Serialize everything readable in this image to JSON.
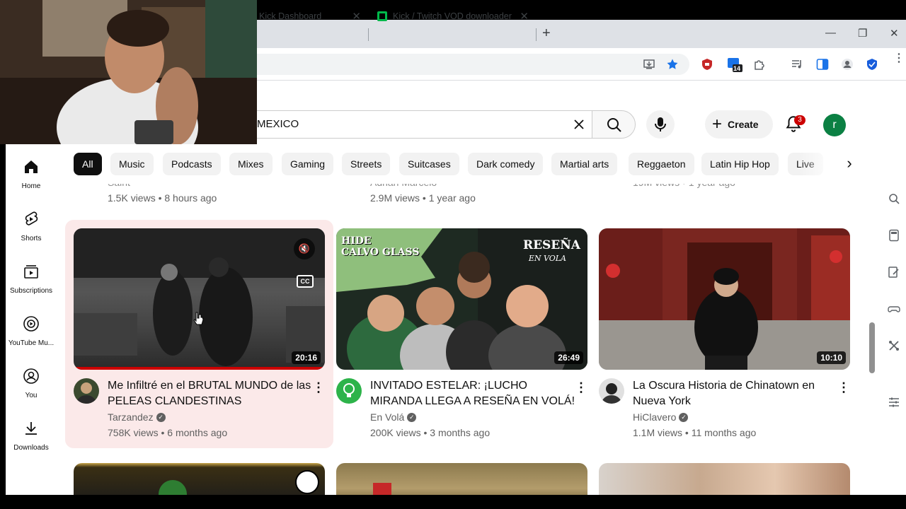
{
  "browser": {
    "tabs": [
      {
        "title": "Kick Dashboard"
      },
      {
        "title": "Kick / Twitch VOD downloader"
      }
    ],
    "new_tab_label": "+",
    "extension_badge": "14"
  },
  "header": {
    "search_query": "MEXICO",
    "create_label": "Create",
    "notifications_count": "3",
    "avatar_letter": "r"
  },
  "chips": [
    "All",
    "Music",
    "Podcasts",
    "Mixes",
    "Gaming",
    "Streets",
    "Suitcases",
    "Dark comedy",
    "Martial arts",
    "Reggaeton",
    "Latin Hip Hop",
    "Live"
  ],
  "sidebar": {
    "items": [
      {
        "label": "Home",
        "icon": "home-icon"
      },
      {
        "label": "Shorts",
        "icon": "shorts-icon"
      },
      {
        "label": "Subscriptions",
        "icon": "subscriptions-icon"
      },
      {
        "label": "YouTube Mu...",
        "icon": "youtube-music-icon"
      },
      {
        "label": "You",
        "icon": "you-icon"
      },
      {
        "label": "Downloads",
        "icon": "download-icon"
      }
    ]
  },
  "previous_row": [
    {
      "channel": "Saint",
      "stats": "1.5K views • 8 hours ago"
    },
    {
      "channel": "Adrian Marcelo",
      "stats": "2.9M views • 1 year ago"
    },
    {
      "channel": "",
      "stats": "19M views • 1 year ago"
    }
  ],
  "videos": [
    {
      "title": "Me Infiltré en el BRUTAL MUNDO de las PELEAS CLANDESTINAS",
      "channel": "Tarzandez",
      "stats": "758K views • 6 months ago",
      "duration": "20:16",
      "muted": true,
      "cc": "CC"
    },
    {
      "title": "INVITADO ESTELAR: ¡LUCHO MIRANDA LLEGA A RESEÑA EN VOLÁ!",
      "channel": "En Volá",
      "stats": "200K views • 3 months ago",
      "duration": "26:49",
      "thumb_text_left": "HIDE\nCALVO GLASS",
      "thumb_text_right": "RESEÑA",
      "thumb_text_right_sub": "EN VOLA"
    },
    {
      "title": "La Oscura Historia de Chinatown en Nueva York",
      "channel": "HiClavero",
      "stats": "1.1M views • 11 months ago",
      "duration": "10:10"
    }
  ],
  "colors": {
    "accent_red": "#cc0000",
    "chip_active": "#0f0f0f",
    "chip_bg": "#f2f2f2",
    "hover_card": "#fbe9e9"
  }
}
